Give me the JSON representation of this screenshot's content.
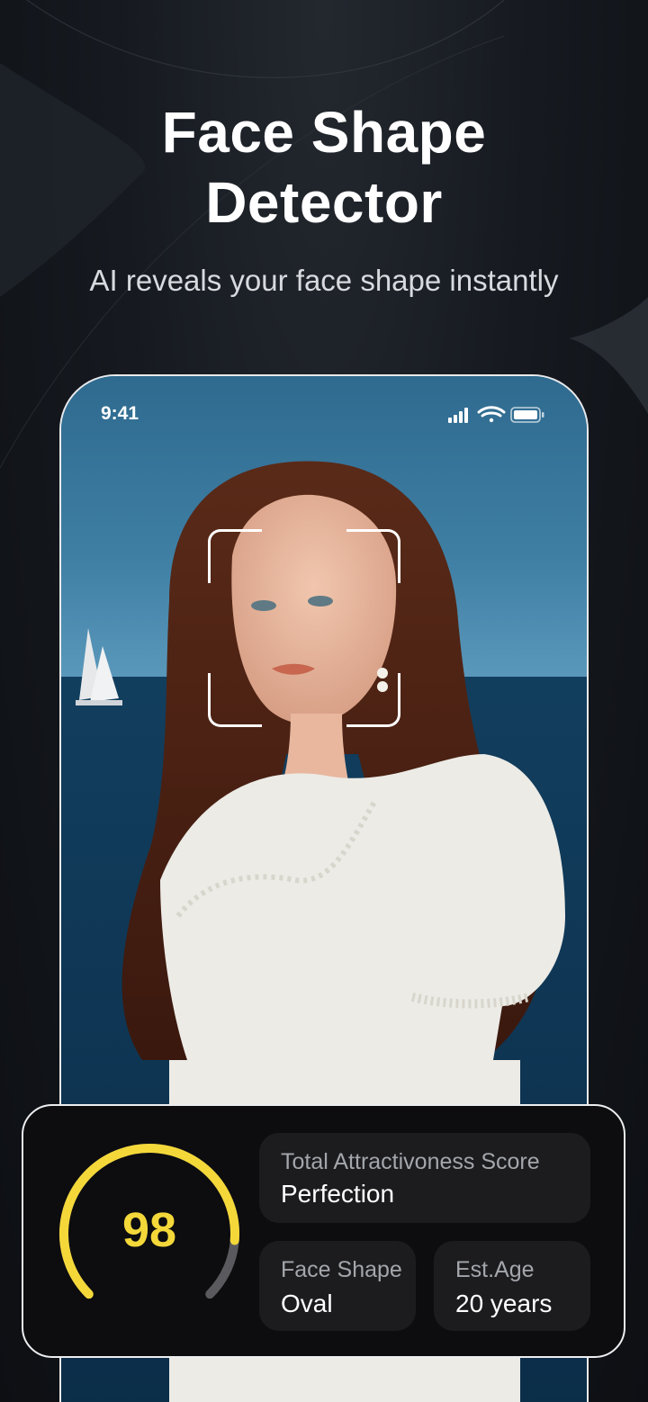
{
  "header": {
    "title_line1": "Face Shape",
    "title_line2": "Detector",
    "subtitle": "AI reveals your face shape instantly"
  },
  "phone": {
    "status_time": "9:41",
    "status_icons": [
      "cellular-signal-icon",
      "wifi-icon",
      "battery-icon"
    ],
    "photo_description_icon": "portrait-photo"
  },
  "result_card": {
    "score": "98",
    "score_fraction": 0.98,
    "score_color": "#f4d83a",
    "attractiveness": {
      "label": "Total Attractivoness Score",
      "value": "Perfection"
    },
    "face_shape": {
      "label": "Face Shape",
      "value": "Oval"
    },
    "age": {
      "label": "Est.Age",
      "value": "20 years"
    }
  }
}
